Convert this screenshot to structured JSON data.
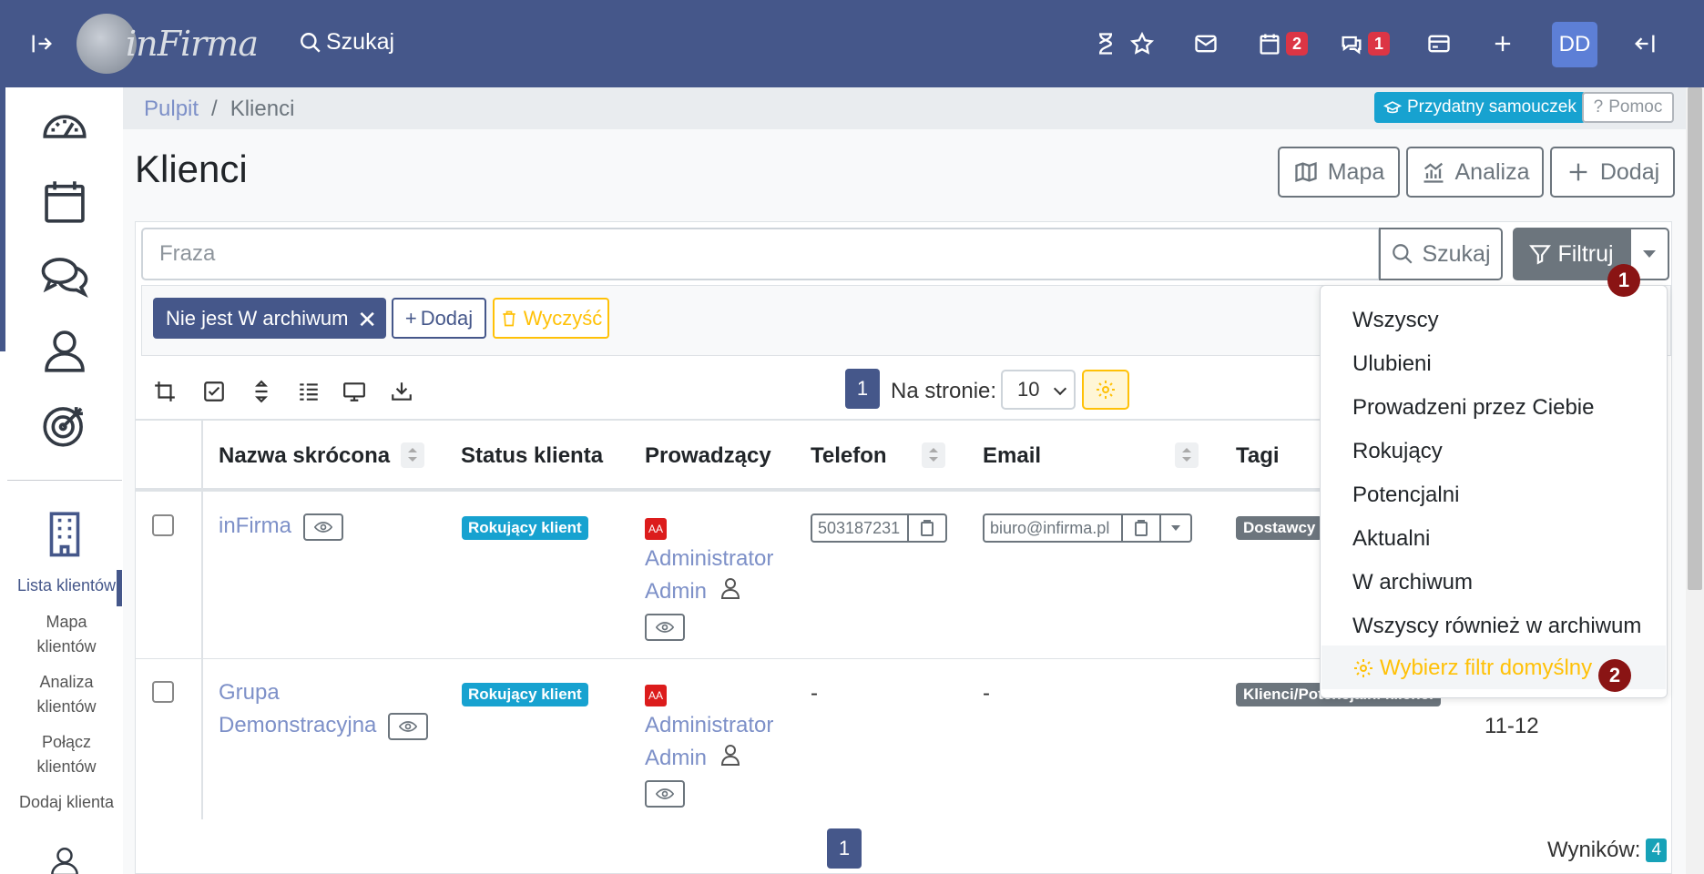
{
  "topbar": {
    "logo_text": "inFirma",
    "search_label": "Szukaj",
    "calendar_badge": "2",
    "chat_badge": "1",
    "avatar_initials": "DD"
  },
  "sidebar": {
    "links": [
      "Lista klientów",
      "Mapa klientów",
      "Analiza klientów",
      "Połącz klientów",
      "Dodaj klienta"
    ]
  },
  "breadcrumb": {
    "home": "Pulpit",
    "separator": "/",
    "current": "Klienci"
  },
  "help": {
    "tutorial": "Przydatny samouczek",
    "help": "Pomoc"
  },
  "page": {
    "title": "Klienci",
    "buttons": {
      "map": "Mapa",
      "analysis": "Analiza",
      "add": "Dodaj"
    }
  },
  "search": {
    "placeholder": "Fraza",
    "search_btn": "Szukaj",
    "filter_btn": "Filtruj"
  },
  "filters": {
    "chip": "Nie jest W archiwum",
    "add": "Dodaj",
    "clear": "Wyczyść"
  },
  "pagination": {
    "current_page": "1",
    "per_page_label": "Na stronie:",
    "per_page_value": "10"
  },
  "table": {
    "headers": [
      "Nazwa skrócona",
      "Status klienta",
      "Prowadzący",
      "Telefon",
      "Email",
      "Tagi"
    ],
    "rows": [
      {
        "name": "inFirma",
        "status": "Rokujący klient",
        "owner_badge": "AA",
        "owner_line1": "Administrator",
        "owner_line2": "Admin",
        "phone": "503187231",
        "email": "biuro@infirma.pl",
        "tag": "Dostawcy"
      },
      {
        "name_line1": "Grupa",
        "name_line2": "Demonstracyjna",
        "status": "Rokujący klient",
        "owner_badge": "AA",
        "owner_line1": "Administrator",
        "owner_line2": "Admin",
        "phone": "-",
        "email": "-",
        "tag": "Klienci/Potencjalni klienci",
        "extra": "11-12"
      }
    ]
  },
  "dropdown": {
    "items": [
      "Wszyscy",
      "Ulubieni",
      "Prowadzeni przez Ciebie",
      "Rokujący",
      "Potencjalni",
      "Aktualni",
      "W archiwum",
      "Wszyscy również w archiwum"
    ],
    "default_filter": "Wybierz filtr domyślny"
  },
  "markers": [
    "1",
    "2"
  ],
  "results": {
    "label": "Wyników:",
    "count": "4"
  },
  "colors": {
    "primary": "#45578a",
    "info": "#17a2d0",
    "warning": "#ffc107",
    "danger": "#dc3545"
  }
}
